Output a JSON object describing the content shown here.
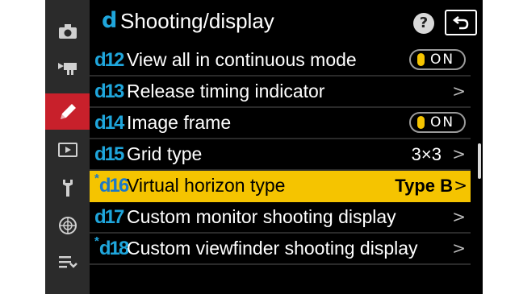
{
  "sidebar": {
    "items": [
      {
        "icon": "camera-icon",
        "active": false
      },
      {
        "icon": "movie-camera-icon",
        "active": false
      },
      {
        "icon": "pencil-icon",
        "active": true
      },
      {
        "icon": "playback-icon",
        "active": false
      },
      {
        "icon": "wrench-icon",
        "active": false
      },
      {
        "icon": "network-icon",
        "active": false
      },
      {
        "icon": "my-menu-icon",
        "active": false
      }
    ]
  },
  "header": {
    "letter": "d",
    "title": "Shooting/display",
    "help_label": "?",
    "back_icon": "back-arrow-icon"
  },
  "rows": [
    {
      "code": "d12",
      "starred": false,
      "label": "View all in continuous mode",
      "toggle": "ON",
      "selected": false
    },
    {
      "code": "d13",
      "starred": false,
      "label": "Release timing indicator",
      "arrow": ">",
      "selected": false
    },
    {
      "code": "d14",
      "starred": false,
      "label": "Image frame",
      "toggle": "ON",
      "selected": false
    },
    {
      "code": "d15",
      "starred": false,
      "label": "Grid type",
      "value": "3×3",
      "arrow": ">",
      "selected": false
    },
    {
      "code": "d16",
      "starred": true,
      "label": "Virtual horizon type",
      "value": "Type  B",
      "arrow": ">",
      "selected": true
    },
    {
      "code": "d17",
      "starred": false,
      "label": "Custom monitor shooting display",
      "arrow": ">",
      "selected": false
    },
    {
      "code": "d18",
      "starred": true,
      "label": "Custom viewfinder shooting display",
      "arrow": ">",
      "selected": false
    }
  ],
  "colors": {
    "accent": "#1fa6dc",
    "highlight": "#f5c400",
    "active_tab": "#c8202b"
  }
}
